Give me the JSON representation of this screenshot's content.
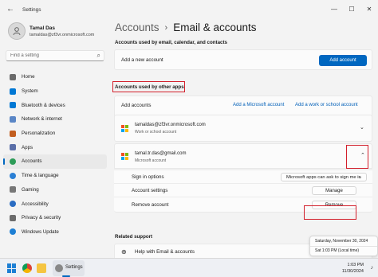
{
  "window": {
    "title": "Settings",
    "minimize_glyph": "—",
    "maximize_glyph": "☐",
    "close_glyph": "✕"
  },
  "profile": {
    "name": "Tamal Das",
    "email": "tamaldas@zf3vr.onmicrosoft.com"
  },
  "search": {
    "placeholder": "Find a setting"
  },
  "nav": [
    {
      "label": "Home",
      "icon": "home-icon",
      "color": "#6a6a6a"
    },
    {
      "label": "System",
      "icon": "system-icon",
      "color": "#0078d4"
    },
    {
      "label": "Bluetooth & devices",
      "icon": "bluetooth-icon",
      "color": "#0078d4"
    },
    {
      "label": "Network & internet",
      "icon": "network-icon",
      "color": "#5a86c6"
    },
    {
      "label": "Personalization",
      "icon": "personalization-icon",
      "color": "#c25e1f"
    },
    {
      "label": "Apps",
      "icon": "apps-icon",
      "color": "#5a6fa8"
    },
    {
      "label": "Accounts",
      "icon": "accounts-icon",
      "color": "#2d9c58",
      "active": true
    },
    {
      "label": "Time & language",
      "icon": "time-language-icon",
      "color": "#2b7fd4"
    },
    {
      "label": "Gaming",
      "icon": "gaming-icon",
      "color": "#777777"
    },
    {
      "label": "Accessibility",
      "icon": "accessibility-icon",
      "color": "#2a6cc2"
    },
    {
      "label": "Privacy & security",
      "icon": "privacy-icon",
      "color": "#6b6b6b"
    },
    {
      "label": "Windows Update",
      "icon": "windows-update-icon",
      "color": "#1d7fd4"
    }
  ],
  "breadcrumb": {
    "parent": "Accounts",
    "separator": "›",
    "current": "Email & accounts"
  },
  "section_email": {
    "heading": "Accounts used by email, calendar, and contacts",
    "add_label": "Add a new account",
    "add_button": "Add account"
  },
  "section_other": {
    "heading": "Accounts used by other apps",
    "add_label": "Add accounts",
    "add_ms_link": "Add a Microsoft account",
    "add_work_link": "Add a work or school account"
  },
  "accounts": [
    {
      "email": "tamaldas@zf3vr.onmicrosoft.com",
      "type": "Work or school account",
      "expanded": false
    },
    {
      "email": "tamal.tr.das@gmail.com",
      "type": "Microsoft account",
      "expanded": true
    }
  ],
  "account_options": {
    "signin_label": "Sign in options",
    "signin_value": "Microsoft apps can ask to sign me in",
    "settings_label": "Account settings",
    "manage_button": "Manage",
    "remove_label": "Remove account",
    "remove_button": "Remove"
  },
  "related": {
    "heading": "Related support",
    "help_item": "Help with Email & accounts"
  },
  "calendar_flyout": {
    "date": "Saturday, November 30, 2024",
    "time": "Sat 1:03 PM (Local time)"
  },
  "taskbar": {
    "settings_label": "Settings",
    "time": "1:03 PM",
    "date": "11/30/2024"
  },
  "colors": {
    "accent": "#0067c0",
    "highlight_red": "#d21f2b"
  }
}
